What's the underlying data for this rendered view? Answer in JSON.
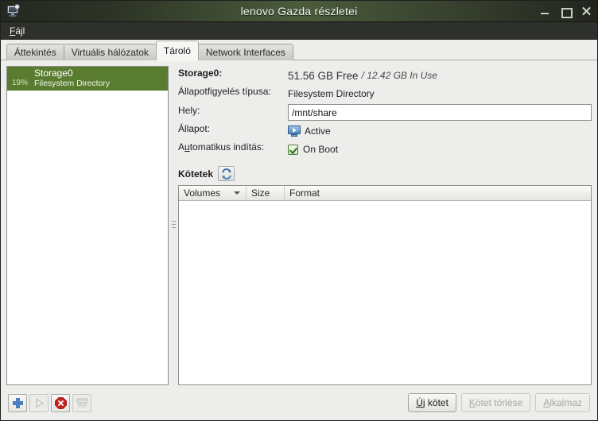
{
  "window": {
    "title": "lenovo Gazda részletei",
    "icon": "computer-gear-icon",
    "controls": {
      "minimize": "minimize-icon",
      "maximize": "maximize-icon",
      "close": "close-icon"
    }
  },
  "menubar": {
    "items": [
      {
        "label": "Fájl",
        "mnemonic": "F",
        "rest": "ájl"
      }
    ]
  },
  "tabs": [
    {
      "label": "Áttekintés",
      "active": false
    },
    {
      "label": "Virtuális hálózatok",
      "active": false
    },
    {
      "label": "Tároló",
      "active": true
    },
    {
      "label": "Network Interfaces",
      "active": false
    }
  ],
  "storage_list": [
    {
      "percent": "19%",
      "name": "Storage0",
      "subtitle": "Filesystem Directory",
      "selected": true,
      "selected_color": "#5a7c30"
    }
  ],
  "details": {
    "name_label": "Storage0:",
    "free_text": "51.56 GB Free",
    "inuse_text": "/ 12.42 GB In Use",
    "pool_type_label": "Állapotfigyelés típusa:",
    "pool_type_value": "Filesystem Directory",
    "location_label": "Hely:",
    "location_value": "/mnt/share",
    "location_placeholder": "",
    "state_label": "Állapot:",
    "state_value": "Active",
    "state_icon": "active-monitor-play-icon",
    "autostart_label": "Automatikus indítás:",
    "autostart_mnemonic": "A",
    "autostart_value": "On Boot",
    "autostart_checked": true
  },
  "volumes_section": {
    "title": "Kötetek",
    "refresh_icon": "refresh-icon",
    "columns": [
      {
        "label": "Volumes",
        "sorted": true,
        "sort_icon": "chevron-down-icon"
      },
      {
        "label": "Size",
        "sorted": false
      },
      {
        "label": "Format",
        "sorted": false
      }
    ],
    "rows": []
  },
  "footer": {
    "icon_buttons": [
      {
        "name": "add-pool-button",
        "icon": "plus-icon",
        "enabled": true
      },
      {
        "name": "start-pool-button",
        "icon": "play-icon",
        "enabled": false
      },
      {
        "name": "stop-pool-button",
        "icon": "stop-octagon-icon",
        "enabled": true
      },
      {
        "name": "delete-pool-button",
        "icon": "shredder-icon",
        "enabled": false
      }
    ],
    "buttons": [
      {
        "label": "Új kötet",
        "mnemonic": "Ú",
        "rest": "j kötet",
        "enabled": true
      },
      {
        "label": "Kötet törlése",
        "mnemonic": "K",
        "rest": "ötet törlése",
        "enabled": false
      },
      {
        "label": "Alkalmaz",
        "mnemonic": "A",
        "rest": "lkalmaz",
        "enabled": false
      }
    ]
  },
  "colors": {
    "titlebar_dark": "#24281f",
    "titlebar_light": "#4b5c3c",
    "menubar": "#2e302c",
    "selection_green": "#5a7c30",
    "accent_blue": "#4a7fbd",
    "stop_red": "#cf1b1b",
    "window_bg": "#ededeb"
  }
}
